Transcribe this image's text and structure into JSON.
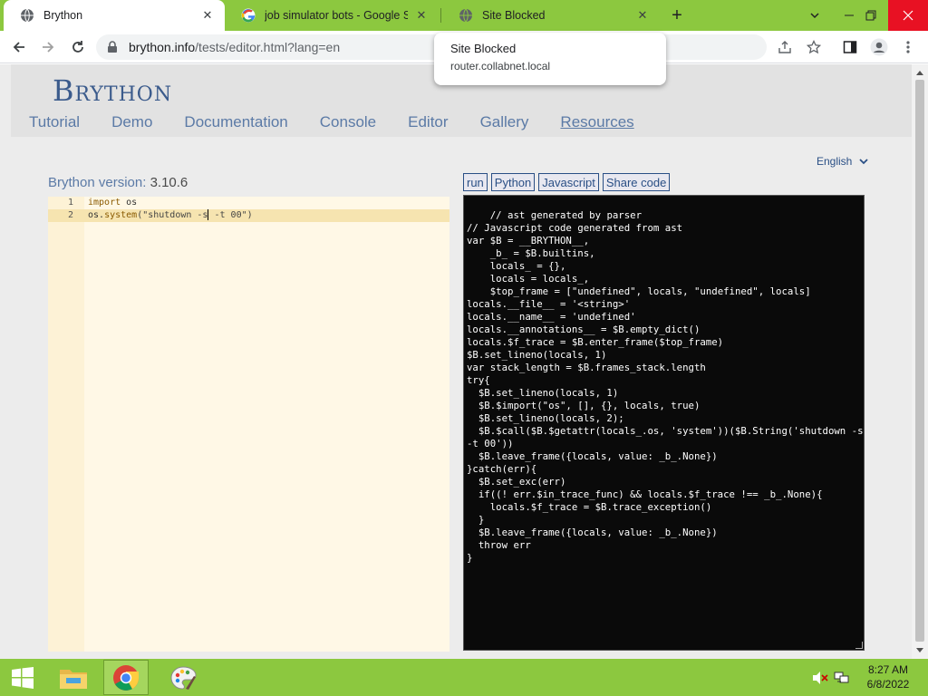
{
  "browser": {
    "tabs": [
      {
        "title": "Brython",
        "close": "✕"
      },
      {
        "title": "job simulator bots - Google Sear",
        "close": "✕"
      },
      {
        "title": "Site Blocked",
        "close": "✕"
      }
    ],
    "new_tab": "+",
    "window": {
      "minimize": "⌄",
      "restore": "–",
      "maximize": "❐",
      "close": "✕"
    },
    "url_host": "brython.info",
    "url_path": "/tests/editor.html?lang=en"
  },
  "popup": {
    "title": "Site Blocked",
    "subtitle": "router.collabnet.local"
  },
  "site": {
    "logo": "Brython",
    "menu": [
      "Tutorial",
      "Demo",
      "Documentation",
      "Console",
      "Editor",
      "Gallery",
      "Resources"
    ],
    "language": "English",
    "version_label": "Brython version: ",
    "version_number": "3.10.6"
  },
  "editor": {
    "line_numbers": [
      "1",
      "2"
    ],
    "line1_keyword": "import",
    "line1_rest": " os",
    "line2_a": "os.",
    "line2_b": "system",
    "line2_c": "(\"shutdown -s",
    "line2_d": " -t 00\")"
  },
  "buttons": {
    "run": "run",
    "python": "Python",
    "javascript": "Javascript",
    "share": "Share code"
  },
  "output": "// ast generated by parser\n// Javascript code generated from ast\nvar $B = __BRYTHON__,\n    _b_ = $B.builtins,\n    locals_ = {},\n    locals = locals_,\n    $top_frame = [\"undefined\", locals, \"undefined\", locals]\nlocals.__file__ = '<string>'\nlocals.__name__ = 'undefined'\nlocals.__annotations__ = $B.empty_dict()\nlocals.$f_trace = $B.enter_frame($top_frame)\n$B.set_lineno(locals, 1)\nvar stack_length = $B.frames_stack.length\ntry{\n  $B.set_lineno(locals, 1)\n  $B.$import(\"os\", [], {}, locals, true)\n  $B.set_lineno(locals, 2);\n  $B.$call($B.$getattr(locals_.os, 'system'))($B.String('shutdown -s -t 00'))\n  $B.leave_frame({locals, value: _b_.None})\n}catch(err){\n  $B.set_exc(err)\n  if((! err.$in_trace_func) && locals.$f_trace !== _b_.None){\n    locals.$f_trace = $B.trace_exception()\n  }\n  $B.leave_frame({locals, value: _b_.None})\n  throw err\n}",
  "taskbar": {
    "time": "8:27 AM",
    "date": "6/8/2022"
  },
  "colors": {
    "chrome_green": "#8cc83f",
    "link_blue": "#5b7aa6",
    "editor_bg": "#fff8e6",
    "output_bg": "#0a0a0a"
  }
}
